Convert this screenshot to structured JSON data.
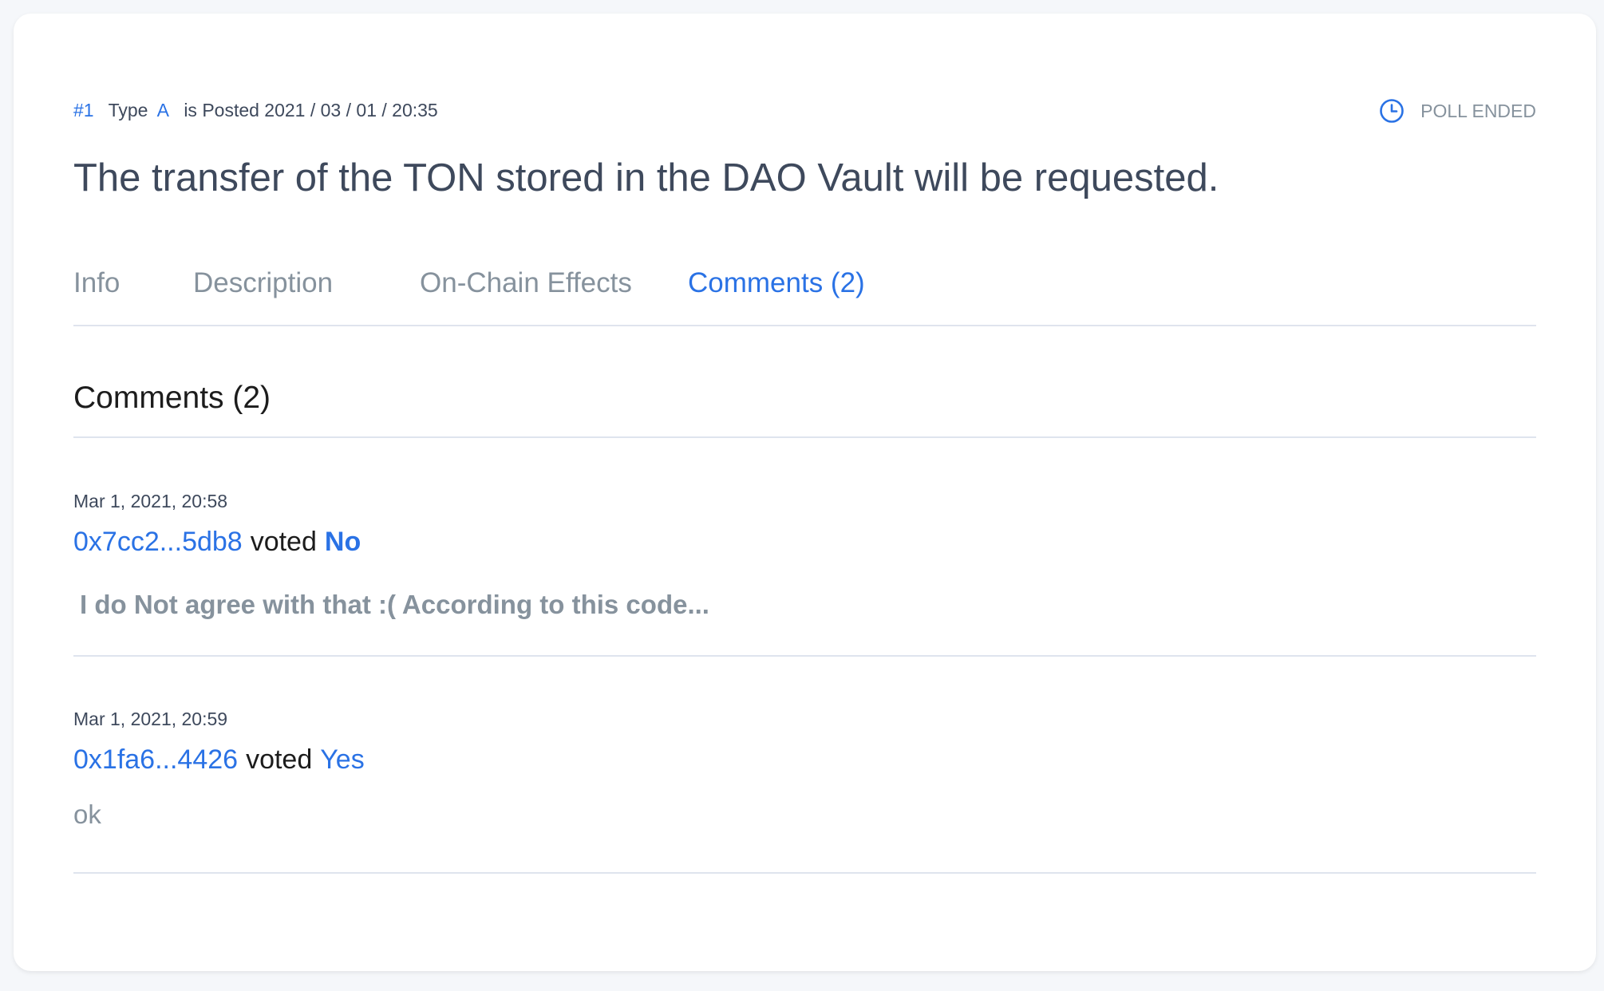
{
  "header": {
    "number": "#1",
    "type_label": "Type",
    "type_value": "A",
    "posted": "is Posted 2021 / 03 / 01 / 20:35",
    "status_icon": "clock-icon",
    "status": "POLL ENDED",
    "title": "The transfer of the TON stored in the DAO Vault will be requested."
  },
  "tabs": [
    {
      "label": "Info",
      "active": false
    },
    {
      "label": "Description",
      "active": false
    },
    {
      "label": "On-Chain Effects",
      "active": false
    },
    {
      "label": "Comments (2)",
      "active": true
    }
  ],
  "comments_section": {
    "title": "Comments (2)",
    "items": [
      {
        "date": "Mar 1, 2021, 20:58",
        "address": "0x7cc2...5db8",
        "voted": "voted",
        "vote": "No",
        "text": "I do Not agree with that :( According to this code..."
      },
      {
        "date": "Mar 1, 2021, 20:59",
        "address": "0x1fa6...4426",
        "voted": "voted",
        "vote": "Yes",
        "text": "ok"
      }
    ]
  },
  "colors": {
    "accent": "#2a72e5",
    "muted": "#86929d",
    "text": "#3e495c",
    "divider": "#dfe4ee"
  }
}
